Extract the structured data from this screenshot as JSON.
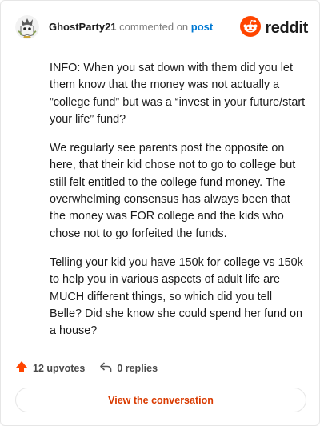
{
  "header": {
    "username": "GhostParty21",
    "action": "commented on",
    "target": "post",
    "brand": "reddit"
  },
  "comment": {
    "paragraphs": [
      "INFO: When you sat down with them did you let them know that the money was not actually a ”college fund” but was a “invest in your future/start your life” fund?",
      "We regularly see parents post the opposite on here, that their kid chose not to go to college but still felt entitled to the college fund money. The overwhelming consensus has always been that the money was FOR college and the kids who chose not to go forfeited the funds.",
      "Telling your kid you have 150k for college vs 150k to help you in various aspects of adult life are MUCH different things, so which did you tell Belle? Did she know she could spend her fund on a house?"
    ]
  },
  "stats": {
    "upvotes": "12 upvotes",
    "replies": "0 replies"
  },
  "cta": {
    "label": "View the conversation"
  },
  "colors": {
    "brand": "#ff4500",
    "link": "#0079d3",
    "cta_text": "#d93a00"
  },
  "icons": [
    "avatar-ghost",
    "reddit-logo-icon",
    "upvote-arrow-icon",
    "reply-icon"
  ]
}
